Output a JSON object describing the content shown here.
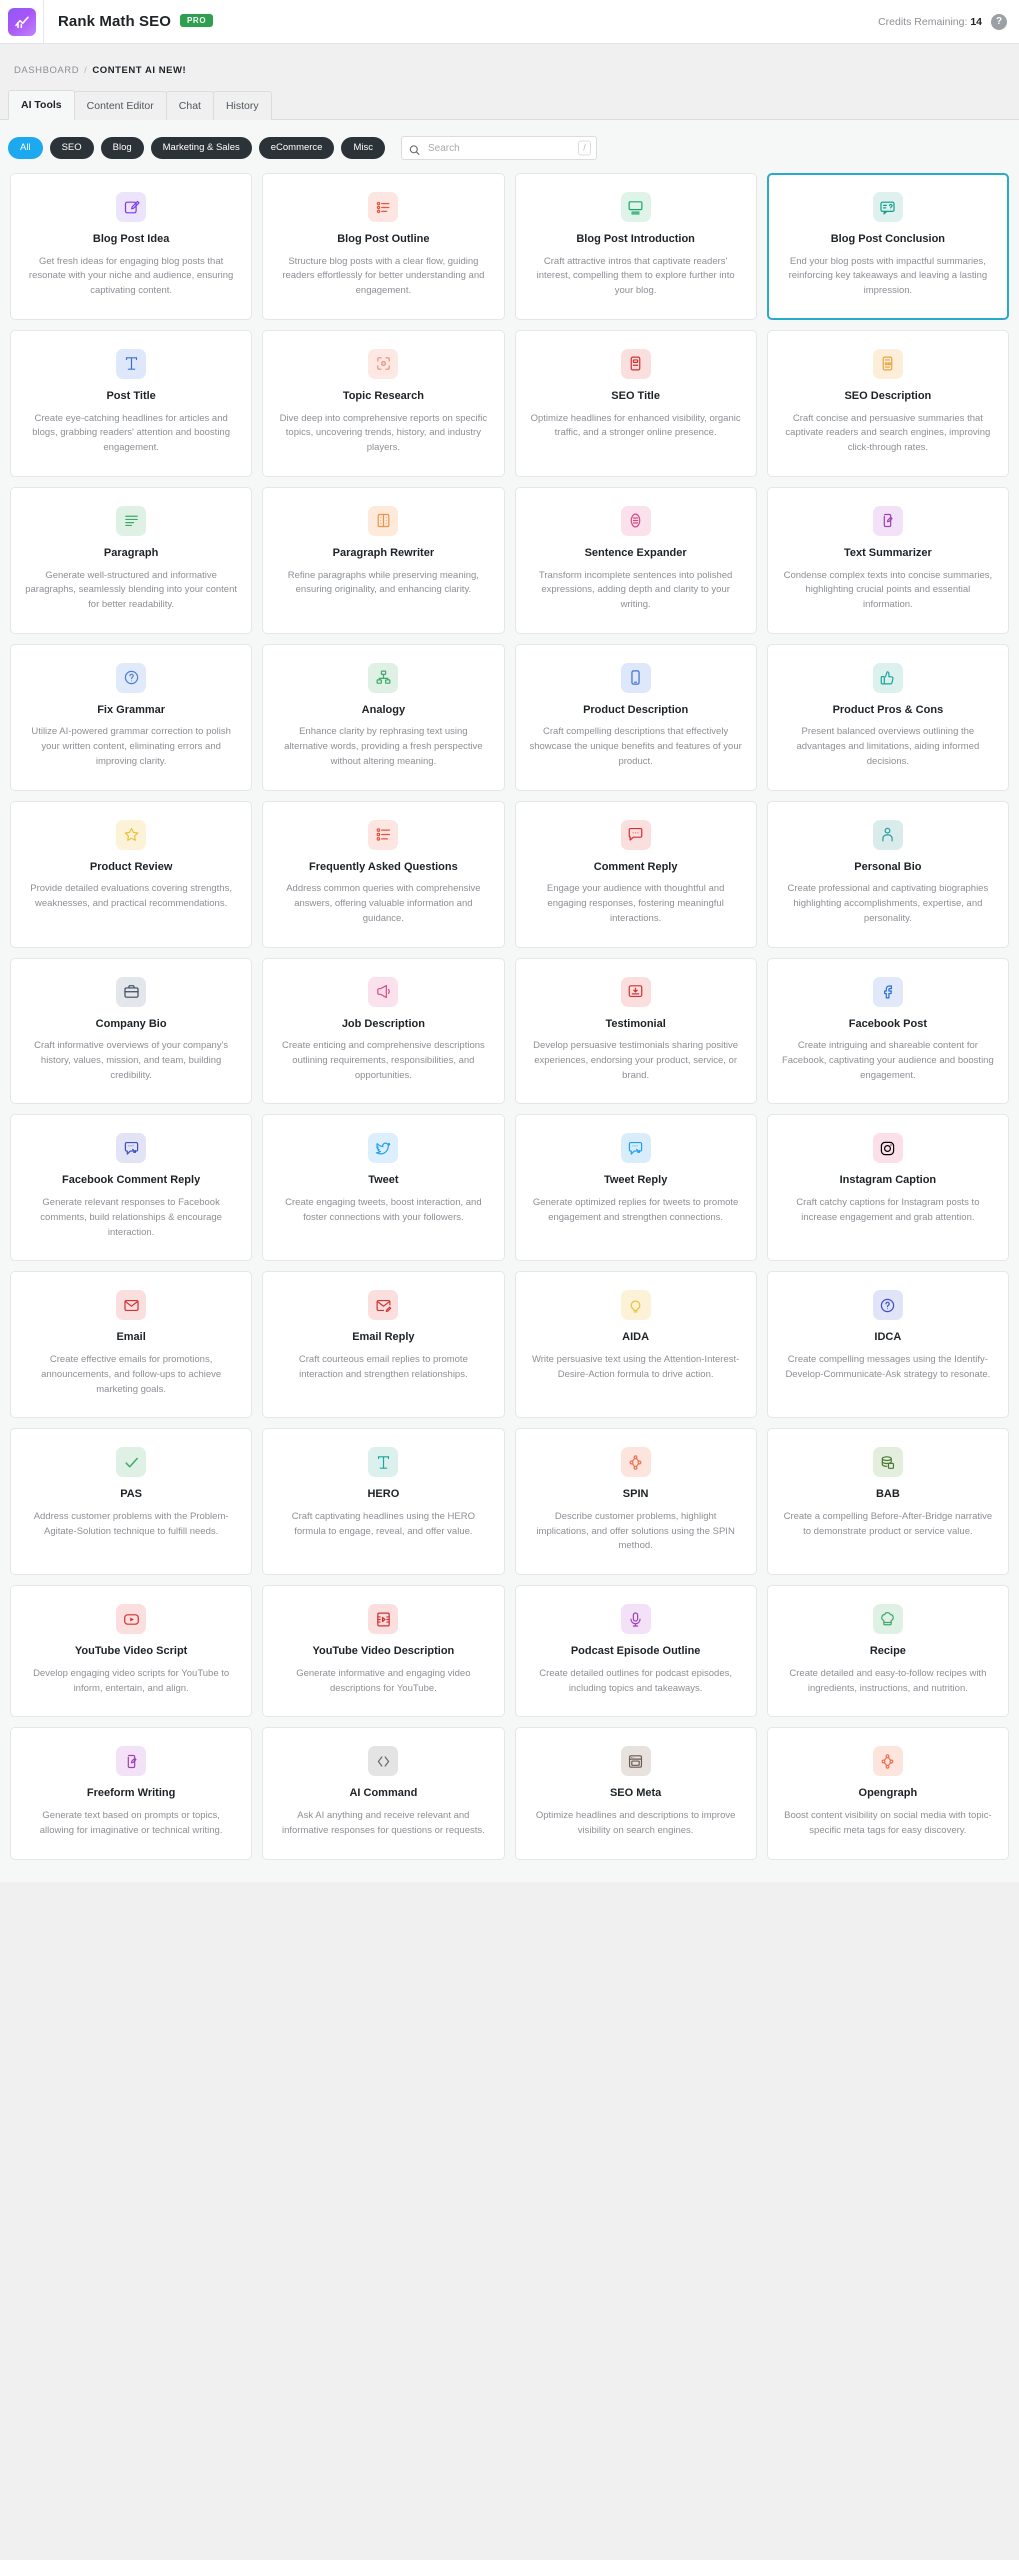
{
  "topbar": {
    "logo_icon": "rank-math-logo-icon",
    "brand": "Rank Math SEO",
    "pro_badge": "PRO",
    "credits_label": "Credits Remaining:",
    "credits_value": "14",
    "help_icon": "?"
  },
  "breadcrumb": {
    "root": "DASHBOARD",
    "separator": "/",
    "current": "CONTENT AI NEW!"
  },
  "tabs": [
    {
      "label": "AI Tools",
      "active": true
    },
    {
      "label": "Content Editor",
      "active": false
    },
    {
      "label": "Chat",
      "active": false
    },
    {
      "label": "History",
      "active": false
    }
  ],
  "filters": {
    "chips": [
      {
        "label": "All",
        "active": true
      },
      {
        "label": "SEO",
        "active": false
      },
      {
        "label": "Blog",
        "active": false
      },
      {
        "label": "Marketing & Sales",
        "active": false
      },
      {
        "label": "eCommerce",
        "active": false
      },
      {
        "label": "Misc",
        "active": false
      }
    ],
    "search_placeholder": "Search",
    "search_value": "",
    "search_icon": "search-icon",
    "shortcut_hint": "/"
  },
  "colors": {
    "accent_blue": "#1da9f0",
    "selected_border": "#2ba9c9",
    "pro_green": "#2e9e4f",
    "page_bg": "#f6f7f7",
    "card_bg": "#ffffff"
  },
  "tools": [
    {
      "title": "Blog Post Idea",
      "desc": "Get fresh ideas for engaging blog posts that resonate with your niche and audience, ensuring captivating content.",
      "icon": "edit-square-icon",
      "icon_fg": "#7c3aed",
      "icon_bg": "#ece4fb",
      "selected": false
    },
    {
      "title": "Blog Post Outline",
      "desc": "Structure blog posts with a clear flow, guiding readers effortlessly for better understanding and engagement.",
      "icon": "ordered-list-icon",
      "icon_fg": "#e8543f",
      "icon_bg": "#fde6e1",
      "selected": false
    },
    {
      "title": "Blog Post Introduction",
      "desc": "Craft attractive intros that captivate readers' interest, compelling them to explore further into your blog.",
      "icon": "monitor-text-icon",
      "icon_fg": "#19a567",
      "icon_bg": "#e0f3e9",
      "selected": false
    },
    {
      "title": "Blog Post Conclusion",
      "desc": "End your blog posts with impactful summaries, reinforcing key takeaways and leaving a lasting impression.",
      "icon": "chat-question-icon",
      "icon_fg": "#0f9d8a",
      "icon_bg": "#dff1ee",
      "selected": true
    },
    {
      "title": "Post Title",
      "desc": "Create eye-catching headlines for articles and blogs, grabbing readers' attention and boosting engagement.",
      "icon": "text-cursor-icon",
      "icon_fg": "#3b6fd4",
      "icon_bg": "#dfe8fa",
      "selected": false
    },
    {
      "title": "Topic Research",
      "desc": "Dive deep into comprehensive reports on specific topics, uncovering trends, history, and industry players.",
      "icon": "focus-target-icon",
      "icon_fg": "#f08a77",
      "icon_bg": "#fde8e3",
      "selected": false
    },
    {
      "title": "SEO Title",
      "desc": "Optimize headlines for enhanced visibility, organic traffic, and a stronger online presence.",
      "icon": "seo-title-icon",
      "icon_fg": "#d33030",
      "icon_bg": "#fbdede",
      "selected": false
    },
    {
      "title": "SEO Description",
      "desc": "Craft concise and persuasive summaries that captivate readers and search engines, improving click-through rates.",
      "icon": "seo-description-icon",
      "icon_fg": "#e8a33d",
      "icon_bg": "#fdeeda",
      "selected": false
    },
    {
      "title": "Paragraph",
      "desc": "Generate well-structured and informative paragraphs, seamlessly blending into your content for better readability.",
      "icon": "paragraph-lines-icon",
      "icon_fg": "#3fa86b",
      "icon_bg": "#dff0e4",
      "selected": false
    },
    {
      "title": "Paragraph Rewriter",
      "desc": "Refine paragraphs while preserving meaning, ensuring originality, and enhancing clarity.",
      "icon": "columns-rewrite-icon",
      "icon_fg": "#ef9244",
      "icon_bg": "#fdeadb",
      "selected": false
    },
    {
      "title": "Sentence Expander",
      "desc": "Transform incomplete sentences into polished expressions, adding depth and clarity to your writing.",
      "icon": "expand-circle-icon",
      "icon_fg": "#d94a86",
      "icon_bg": "#fbe1ec",
      "selected": false
    },
    {
      "title": "Text Summarizer",
      "desc": "Condense complex texts into concise summaries, highlighting crucial points and essential information.",
      "icon": "summarize-doc-icon",
      "icon_fg": "#a23fb8",
      "icon_bg": "#f2e1f7",
      "selected": false
    },
    {
      "title": "Fix Grammar",
      "desc": "Utilize AI-powered grammar correction to polish your written content, eliminating errors and improving clarity.",
      "icon": "help-circle-icon",
      "icon_fg": "#4a7fd6",
      "icon_bg": "#e1eafb",
      "selected": false
    },
    {
      "title": "Analogy",
      "desc": "Enhance clarity by rephrasing text using alternative words, providing a fresh perspective without altering meaning.",
      "icon": "hierarchy-icon",
      "icon_fg": "#3fa86b",
      "icon_bg": "#dff0e4",
      "selected": false
    },
    {
      "title": "Product Description",
      "desc": "Craft compelling descriptions that effectively showcase the unique benefits and features of your product.",
      "icon": "mobile-product-icon",
      "icon_fg": "#3b6fd4",
      "icon_bg": "#dfe8fa",
      "selected": false
    },
    {
      "title": "Product Pros & Cons",
      "desc": "Present balanced overviews outlining the advantages and limitations, aiding informed decisions.",
      "icon": "thumbs-up-icon",
      "icon_fg": "#19a89a",
      "icon_bg": "#dcf0ee",
      "selected": false
    },
    {
      "title": "Product Review",
      "desc": "Provide detailed evaluations covering strengths, weaknesses, and practical recommendations.",
      "icon": "star-icon",
      "icon_fg": "#e8c33d",
      "icon_bg": "#fcf2d8",
      "selected": false
    },
    {
      "title": "Frequently Asked Questions",
      "desc": "Address common queries with comprehensive answers, offering valuable information and guidance.",
      "icon": "faq-list-icon",
      "icon_fg": "#e8543f",
      "icon_bg": "#fde6e1",
      "selected": false
    },
    {
      "title": "Comment Reply",
      "desc": "Engage your audience with thoughtful and engaging responses, fostering meaningful interactions.",
      "icon": "comment-dots-icon",
      "icon_fg": "#d33030",
      "icon_bg": "#fbdede",
      "selected": false
    },
    {
      "title": "Personal Bio",
      "desc": "Create professional and captivating biographies highlighting accomplishments, expertise, and personality.",
      "icon": "person-icon",
      "icon_fg": "#2a9d9a",
      "icon_bg": "#d9eceb",
      "selected": false
    },
    {
      "title": "Company Bio",
      "desc": "Craft informative overviews of your company's history, values, mission, and team, building credibility.",
      "icon": "briefcase-icon",
      "icon_fg": "#3c4a5e",
      "icon_bg": "#e3e7ec",
      "selected": false
    },
    {
      "title": "Job Description",
      "desc": "Create enticing and comprehensive descriptions outlining requirements, responsibilities, and opportunities.",
      "icon": "megaphone-icon",
      "icon_fg": "#d94a86",
      "icon_bg": "#fbe1ec",
      "selected": false
    },
    {
      "title": "Testimonial",
      "desc": "Develop persuasive testimonials sharing positive experiences, endorsing your product, service, or brand.",
      "icon": "testimonial-badge-icon",
      "icon_fg": "#d33030",
      "icon_bg": "#fbdede",
      "selected": false
    },
    {
      "title": "Facebook Post",
      "desc": "Create intriguing and shareable content for Facebook, captivating your audience and boosting engagement.",
      "icon": "facebook-icon",
      "icon_fg": "#2f6bd4",
      "icon_bg": "#e0e8fa",
      "selected": false
    },
    {
      "title": "Facebook Comment Reply",
      "desc": "Generate relevant responses to Facebook comments, build relationships & encourage interaction.",
      "icon": "facebook-comment-icon",
      "icon_fg": "#3a4fc4",
      "icon_bg": "#e2e4f5",
      "selected": false
    },
    {
      "title": "Tweet",
      "desc": "Create engaging tweets, boost interaction, and foster connections with your followers.",
      "icon": "twitter-bird-icon",
      "icon_fg": "#1da1f2",
      "icon_bg": "#ddeffc",
      "selected": false
    },
    {
      "title": "Tweet Reply",
      "desc": "Generate optimized replies for tweets to promote engagement and strengthen connections.",
      "icon": "twitter-reply-icon",
      "icon_fg": "#1da1f2",
      "icon_bg": "#d9ecfa",
      "selected": false
    },
    {
      "title": "Instagram Caption",
      "desc": "Craft catchy captions for Instagram posts to increase engagement and grab attention.",
      "icon": "instagram-icon",
      "icon_fg": "#ef २",
      "icon_bg": "#fbdfe9",
      "selected": false
    },
    {
      "title": "Email",
      "desc": "Create effective emails for promotions, announcements, and follow-ups to achieve marketing goals.",
      "icon": "envelope-icon",
      "icon_fg": "#d33030",
      "icon_bg": "#fbdede",
      "selected": false
    },
    {
      "title": "Email Reply",
      "desc": "Craft courteous email replies to promote interaction and strengthen relationships.",
      "icon": "envelope-edit-icon",
      "icon_fg": "#d33030",
      "icon_bg": "#fbdede",
      "selected": false
    },
    {
      "title": "AIDA",
      "desc": "Write persuasive text using the Attention-Interest-Desire-Action formula to drive action.",
      "icon": "lightbulb-icon",
      "icon_fg": "#e8c33d",
      "icon_bg": "#fcf2d8",
      "selected": false
    },
    {
      "title": "IDCA",
      "desc": "Create compelling messages using the Identify-Develop-Communicate-Ask strategy to resonate.",
      "icon": "question-circle-icon",
      "icon_fg": "#3f4fc4",
      "icon_bg": "#e1e4f7",
      "selected": false
    },
    {
      "title": "PAS",
      "desc": "Address customer problems with the Problem-Agitate-Solution technique to fulfill needs.",
      "icon": "check-icon",
      "icon_fg": "#3fa86b",
      "icon_bg": "#dff0e4",
      "selected": false
    },
    {
      "title": "HERO",
      "desc": "Craft captivating headlines using the HERO formula to engage, reveal, and offer value.",
      "icon": "text-cursor-icon",
      "icon_fg": "#19a89a",
      "icon_bg": "#dcf0ee",
      "selected": false
    },
    {
      "title": "SPIN",
      "desc": "Describe customer problems, highlight implications, and offer solutions using the SPIN method.",
      "icon": "network-nodes-icon",
      "icon_fg": "#ef7050",
      "icon_bg": "#fde5de",
      "selected": false
    },
    {
      "title": "BAB",
      "desc": "Create a compelling Before-After-Bridge narrative to demonstrate product or service value.",
      "icon": "stack-layers-icon",
      "icon_fg": "#4a7a3a",
      "icon_bg": "#e3efdc",
      "selected": false
    },
    {
      "title": "YouTube Video Script",
      "desc": "Develop engaging video scripts for YouTube to inform, entertain, and align.",
      "icon": "youtube-icon",
      "icon_fg": "#d33030",
      "icon_bg": "#fbdede",
      "selected": false
    },
    {
      "title": "YouTube Video Description",
      "desc": "Generate informative and engaging video descriptions for YouTube.",
      "icon": "film-strip-icon",
      "icon_fg": "#d33030",
      "icon_bg": "#fbdede",
      "selected": false
    },
    {
      "title": "Podcast Episode Outline",
      "desc": "Create detailed outlines for podcast episodes, including topics and takeaways.",
      "icon": "microphone-icon",
      "icon_fg": "#a23fb8",
      "icon_bg": "#f2e1f7",
      "selected": false
    },
    {
      "title": "Recipe",
      "desc": "Create detailed and easy-to-follow recipes with ingredients, instructions, and nutrition.",
      "icon": "chef-hat-icon",
      "icon_fg": "#3fa86b",
      "icon_bg": "#dff0e4",
      "selected": false
    },
    {
      "title": "Freeform Writing",
      "desc": "Generate text based on prompts or topics, allowing for imaginative or technical writing.",
      "icon": "summarize-doc-icon",
      "icon_fg": "#a23fb8",
      "icon_bg": "#f2e1f7",
      "selected": false
    },
    {
      "title": "AI Command",
      "desc": "Ask AI anything and receive relevant and informative responses for questions or requests.",
      "icon": "code-brackets-icon",
      "icon_fg": "#646970",
      "icon_bg": "#e4e4e4",
      "selected": false
    },
    {
      "title": "SEO Meta",
      "desc": "Optimize headlines and descriptions to improve visibility on search engines.",
      "icon": "seo-meta-icon",
      "icon_fg": "#6b5a52",
      "icon_bg": "#e8e2de",
      "selected": false
    },
    {
      "title": "Opengraph",
      "desc": "Boost content visibility on social media with topic-specific meta tags for easy discovery.",
      "icon": "network-nodes-icon",
      "icon_fg": "#ef7050",
      "icon_bg": "#fde5de",
      "selected": false
    }
  ]
}
